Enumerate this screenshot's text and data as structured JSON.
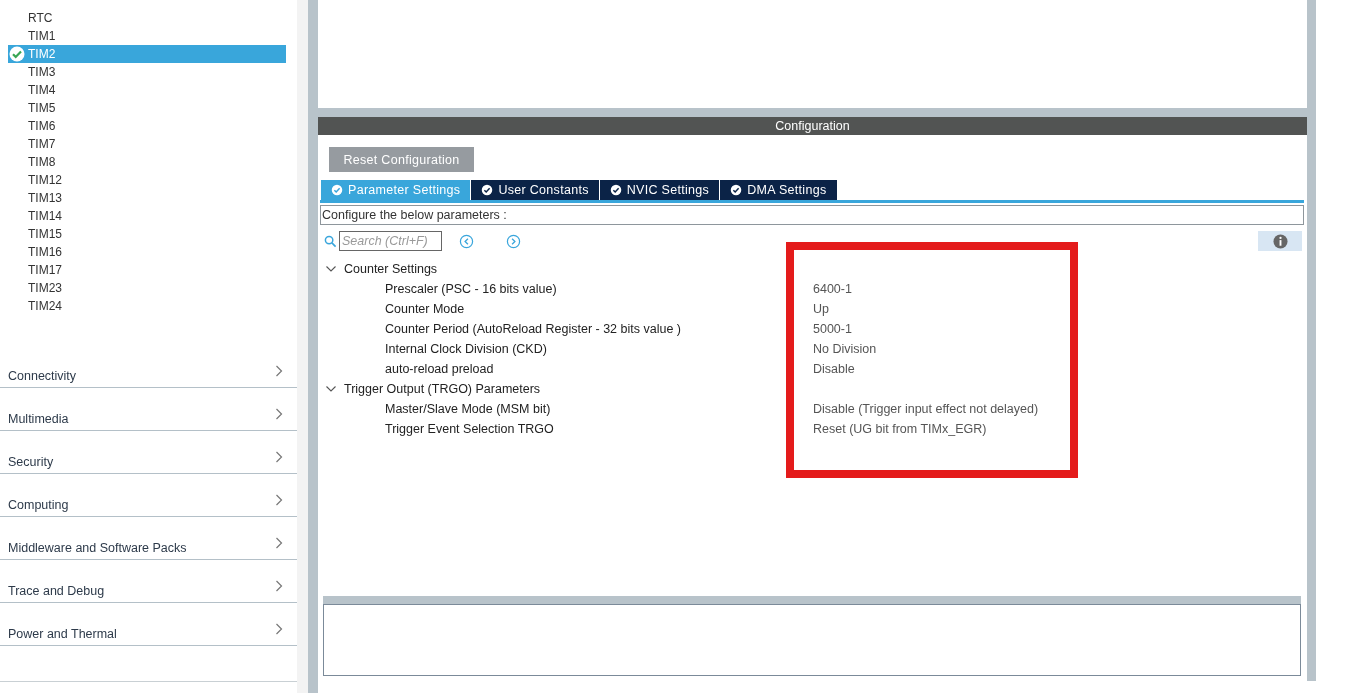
{
  "peripherals": [
    {
      "label": "RTC",
      "selected": false,
      "configured": false
    },
    {
      "label": "TIM1",
      "selected": false,
      "configured": false
    },
    {
      "label": "TIM2",
      "selected": true,
      "configured": true
    },
    {
      "label": "TIM3",
      "selected": false,
      "configured": false
    },
    {
      "label": "TIM4",
      "selected": false,
      "configured": false
    },
    {
      "label": "TIM5",
      "selected": false,
      "configured": false
    },
    {
      "label": "TIM6",
      "selected": false,
      "configured": false
    },
    {
      "label": "TIM7",
      "selected": false,
      "configured": false
    },
    {
      "label": "TIM8",
      "selected": false,
      "configured": false
    },
    {
      "label": "TIM12",
      "selected": false,
      "configured": false
    },
    {
      "label": "TIM13",
      "selected": false,
      "configured": false
    },
    {
      "label": "TIM14",
      "selected": false,
      "configured": false
    },
    {
      "label": "TIM15",
      "selected": false,
      "configured": false
    },
    {
      "label": "TIM16",
      "selected": false,
      "configured": false
    },
    {
      "label": "TIM17",
      "selected": false,
      "configured": false
    },
    {
      "label": "TIM23",
      "selected": false,
      "configured": false
    },
    {
      "label": "TIM24",
      "selected": false,
      "configured": false
    }
  ],
  "categories": [
    "Connectivity",
    "Multimedia",
    "Security",
    "Computing",
    "Middleware and Software Packs",
    "Trace and Debug",
    "Power and Thermal"
  ],
  "configuration": {
    "title": "Configuration",
    "reset_button": "Reset Configuration",
    "tabs": [
      {
        "label": "Parameter Settings",
        "selected": true
      },
      {
        "label": "User Constants",
        "selected": false
      },
      {
        "label": "NVIC Settings",
        "selected": false
      },
      {
        "label": "DMA Settings",
        "selected": false
      }
    ],
    "hint": "Configure the below parameters :",
    "search": {
      "placeholder": "Search (Ctrl+F)"
    },
    "groups": [
      {
        "label": "Counter Settings",
        "expanded": true,
        "children": [
          {
            "name": "Prescaler (PSC - 16 bits value)",
            "value": "6400-1"
          },
          {
            "name": "Counter Mode",
            "value": "Up"
          },
          {
            "name": "Counter Period (AutoReload Register - 32 bits value )",
            "value": "5000-1"
          },
          {
            "name": "Internal Clock Division (CKD)",
            "value": "No Division"
          },
          {
            "name": "auto-reload preload",
            "value": "Disable"
          }
        ]
      },
      {
        "label": "Trigger Output (TRGO) Parameters",
        "expanded": true,
        "children": [
          {
            "name": "Master/Slave Mode (MSM bit)",
            "value": "Disable (Trigger input effect not delayed)"
          },
          {
            "name": "Trigger Event Selection TRGO",
            "value": "Reset (UG bit from TIMx_EGR)"
          }
        ]
      }
    ]
  },
  "annotation": {
    "kind": "rectangle"
  }
}
